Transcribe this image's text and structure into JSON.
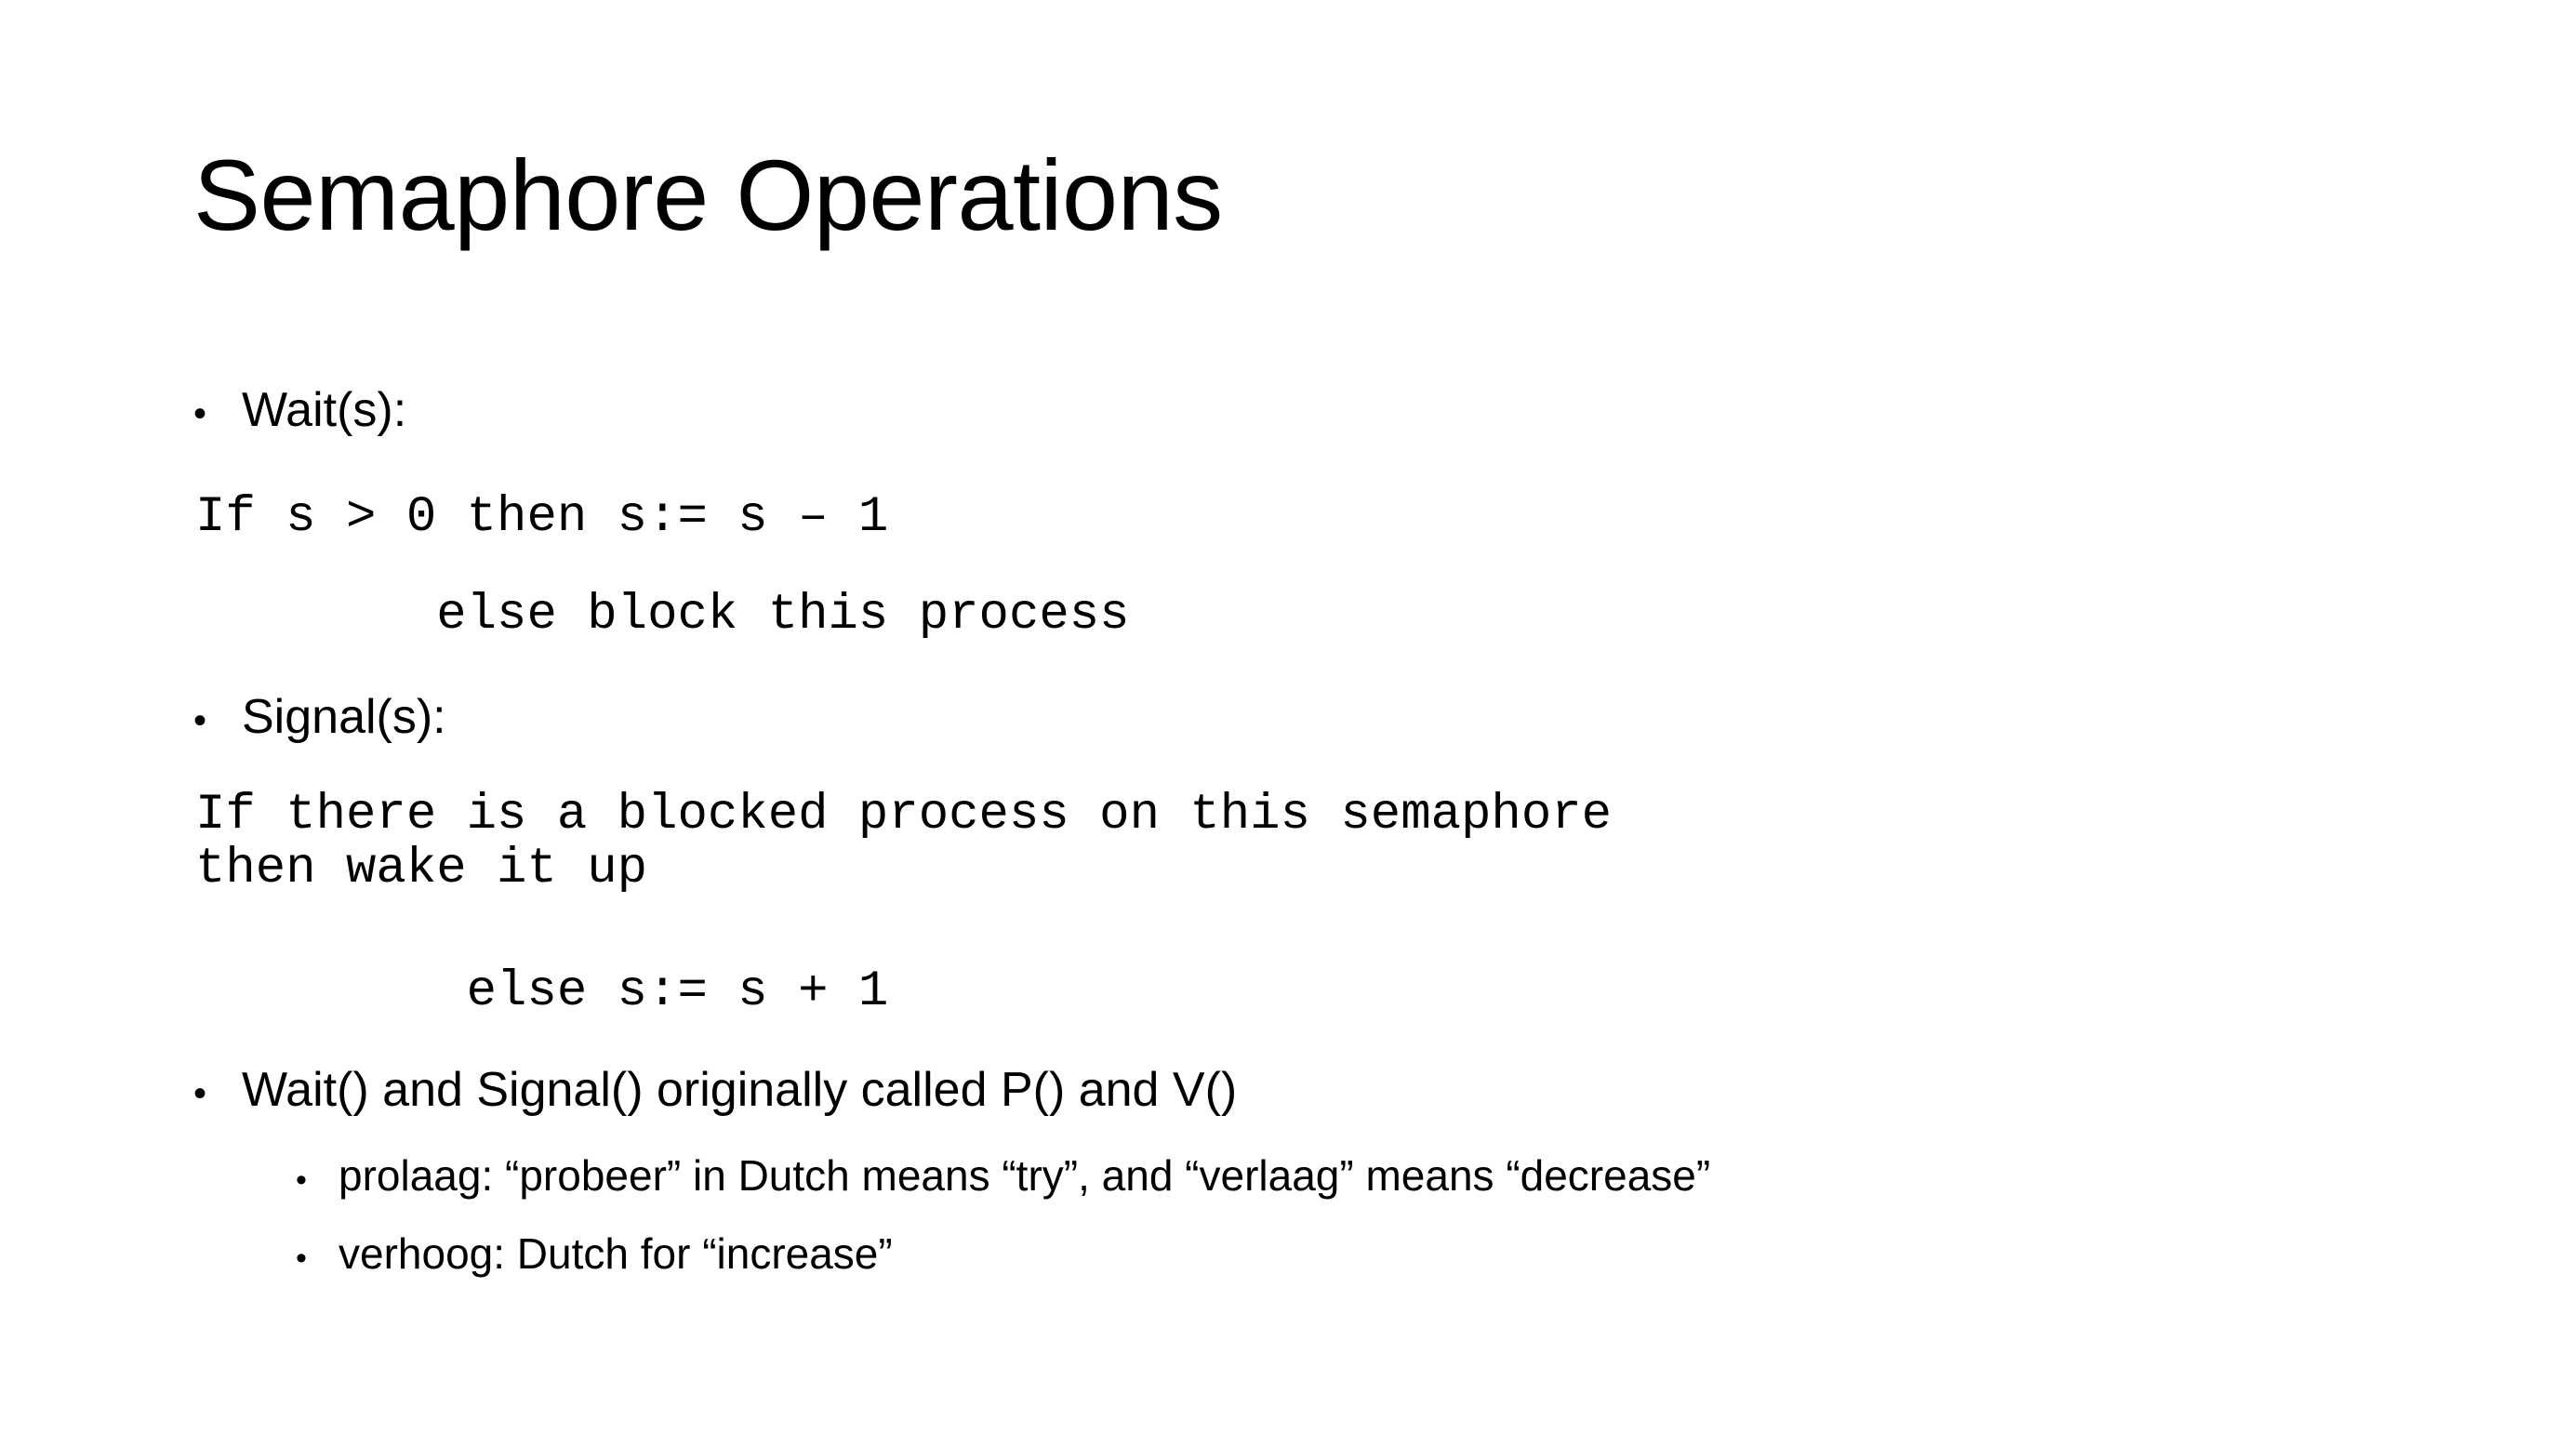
{
  "slide": {
    "title": "Semaphore Operations",
    "background_color": "#FFFFFF",
    "text_color": "#000000"
  },
  "content": {
    "wait_bullet": {
      "marker": "•",
      "label": "Wait(s):"
    },
    "wait_code_line_1": "If s > 0 then s:= s – 1",
    "wait_code_line_2": "        else block this process",
    "signal_bullet": {
      "marker": "•",
      "label": "Signal(s):"
    },
    "signal_code_line_1": "If there is a blocked process on this semaphore\nthen wake it up",
    "signal_code_line_2": "         else s:= s + 1",
    "origin_bullet": {
      "marker": "•",
      "label": "Wait() and Signal() originally called P() and V()"
    },
    "sub_bullets": [
      {
        "marker": "•",
        "label": "prolaag: “probeer” in Dutch means “try”, and “verlaag” means “decrease”"
      },
      {
        "marker": "•",
        "label": "verhoog: Dutch for “increase”"
      }
    ]
  }
}
